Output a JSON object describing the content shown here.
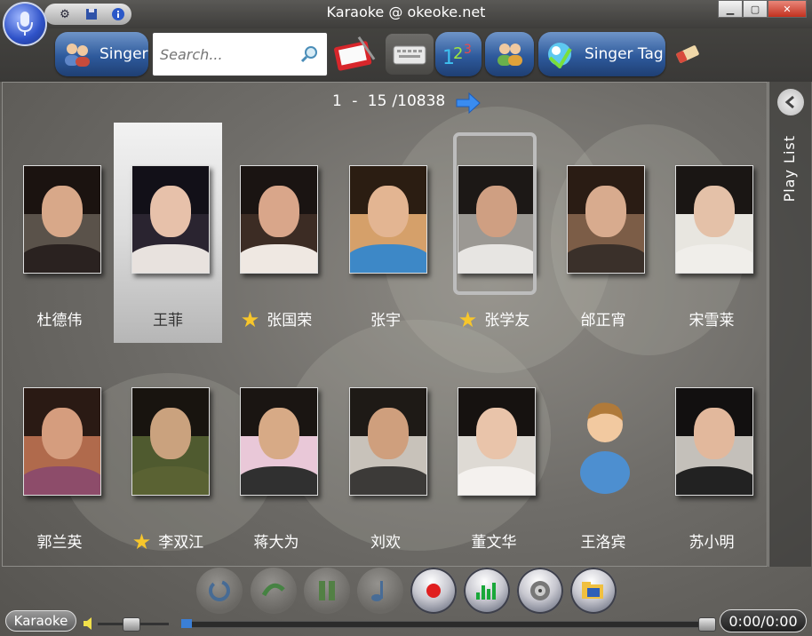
{
  "window": {
    "title": "Karaoke @ okeoke.net"
  },
  "toolbar": {
    "singer_label": "Singer",
    "search_placeholder": "Search...",
    "singer_tag_label": "Singer Tag"
  },
  "pager": {
    "start": "1",
    "dash": "-",
    "end": "15",
    "sep": "/",
    "total": "10838"
  },
  "side": {
    "playlist_label": "Play List"
  },
  "singers": [
    {
      "name": "杜德伟",
      "fav": false,
      "selected": false,
      "hair": "#1b1310",
      "face": "#d8a889",
      "body": "#2a2220",
      "bg": "#5a524a"
    },
    {
      "name": "王菲",
      "fav": false,
      "selected": true,
      "hair": "#121018",
      "face": "#e7c1aa",
      "body": "#e8e2de",
      "bg": "#2a2430"
    },
    {
      "name": "张国荣",
      "fav": true,
      "selected": false,
      "hair": "#1a1412",
      "face": "#d9a68a",
      "body": "#efe8e2",
      "bg": "#3c2c24"
    },
    {
      "name": "张宇",
      "fav": false,
      "selected": false,
      "hair": "#2b1d12",
      "face": "#e3b592",
      "body": "#3d88c7",
      "bg": "#d5a06a"
    },
    {
      "name": "张学友",
      "fav": true,
      "selected": false,
      "hair": "#1c1816",
      "face": "#cf9f82",
      "body": "#e7e5e2",
      "bg": "#9b9893"
    },
    {
      "name": "邰正宵",
      "fav": false,
      "selected": false,
      "hair": "#2a1c14",
      "face": "#d8ab8e",
      "body": "#3a302a",
      "bg": "#7c5d47"
    },
    {
      "name": "宋雪莱",
      "fav": false,
      "selected": false,
      "hair": "#1a1614",
      "face": "#e4c1a8",
      "body": "#f0eeea",
      "bg": "#e8e6e0"
    },
    {
      "name": "郭兰英",
      "fav": false,
      "selected": false,
      "hair": "#2a1a14",
      "face": "#d59d7e",
      "body": "#8d4c6a",
      "bg": "#b06a4c"
    },
    {
      "name": "李双江",
      "fav": true,
      "selected": false,
      "hair": "#18140f",
      "face": "#caa27e",
      "body": "#5a6233",
      "bg": "#4f5a2f"
    },
    {
      "name": "蒋大为",
      "fav": false,
      "selected": false,
      "hair": "#1a1512",
      "face": "#d7aa86",
      "body": "#303030",
      "bg": "#e9c8d8"
    },
    {
      "name": "刘欢",
      "fav": false,
      "selected": false,
      "hair": "#1e1a16",
      "face": "#cf9f7d",
      "body": "#3c3a38",
      "bg": "#c8c2ba"
    },
    {
      "name": "董文华",
      "fav": false,
      "selected": false,
      "hair": "#161210",
      "face": "#e9c4aa",
      "body": "#f4f1ee",
      "bg": "#dedad4"
    },
    {
      "name": "王洛宾",
      "fav": false,
      "selected": false,
      "hair": "#b07a3a",
      "face": "#f2c9a0",
      "body": "#4d8fd0",
      "bg": "transparent",
      "placeholder": true
    },
    {
      "name": "苏小明",
      "fav": false,
      "selected": false,
      "hair": "#121010",
      "face": "#e2b89c",
      "body": "#222",
      "bg": "#c4c0ba"
    }
  ],
  "player": {
    "mode_label": "Karaoke",
    "time": "0:00/0:00",
    "volume": 0.45,
    "progress": 0.0
  }
}
